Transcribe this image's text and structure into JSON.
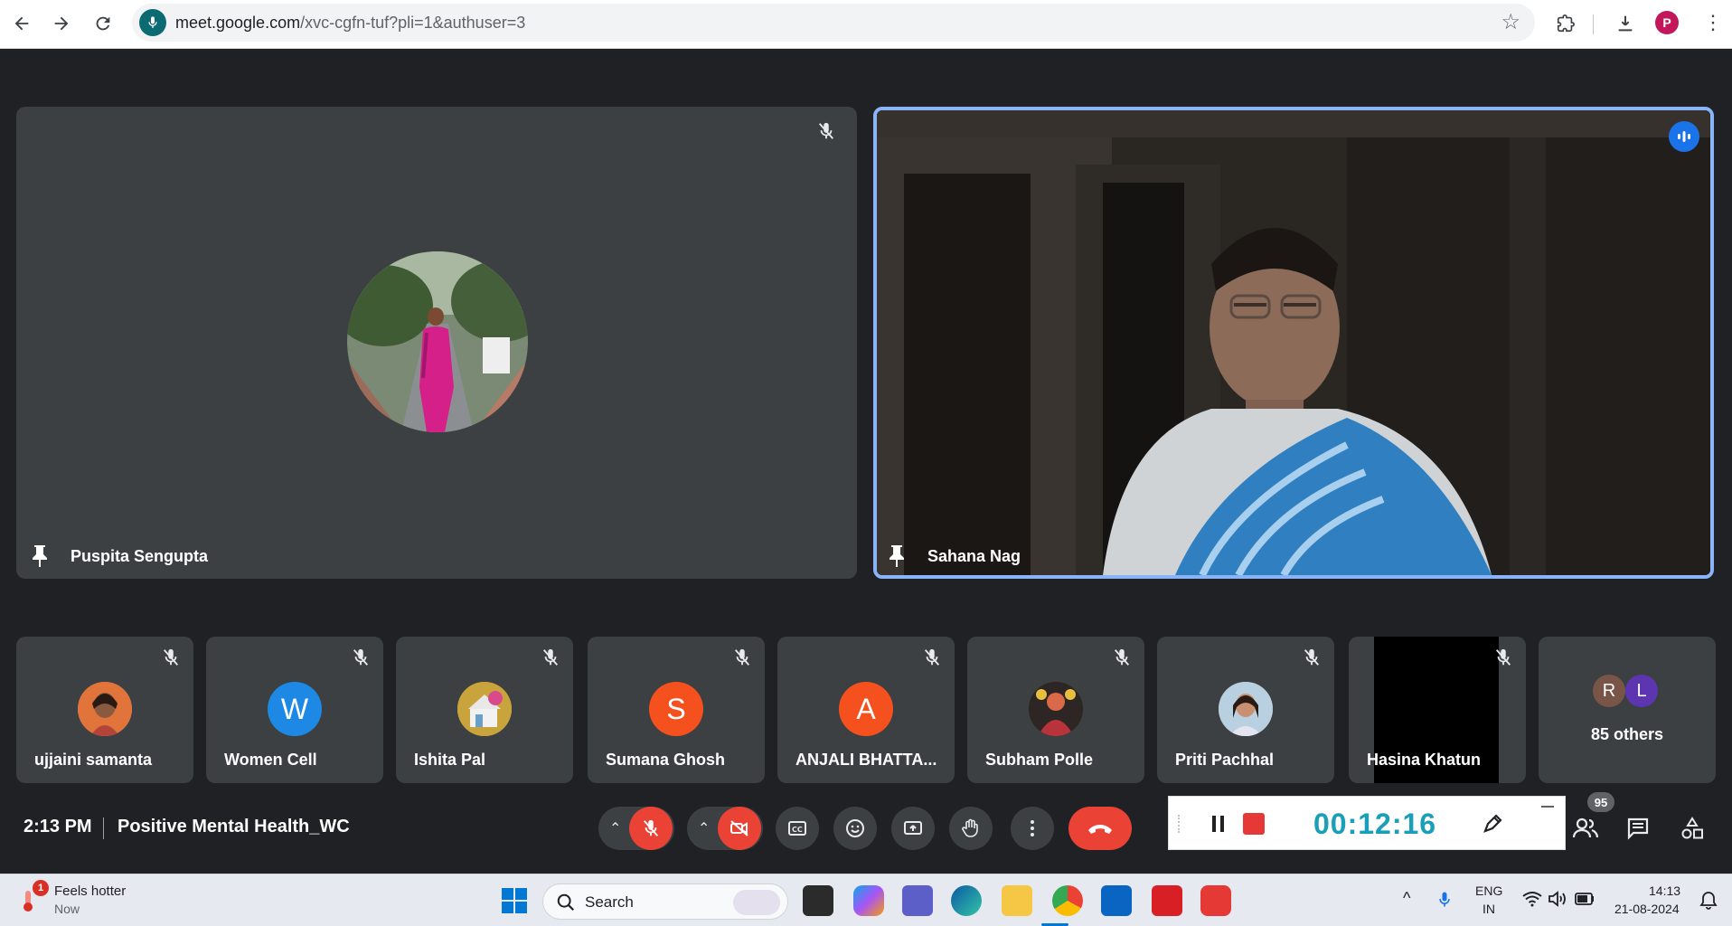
{
  "browser": {
    "url_host": "meet.google.com",
    "url_rest": "/xvc-cgfn-tuf?pli=1&authuser=3",
    "profile_initial": "P"
  },
  "main_tiles": [
    {
      "name": "Puspita Sengupta"
    },
    {
      "name": "Sahana Nag"
    }
  ],
  "strip": [
    {
      "name": "ujjaini samanta",
      "type": "photo"
    },
    {
      "name": "Women Cell",
      "initial": "W",
      "color": "#1e88e5"
    },
    {
      "name": "Ishita Pal",
      "type": "photo"
    },
    {
      "name": "Sumana Ghosh",
      "initial": "S",
      "color": "#f4511e"
    },
    {
      "name": "ANJALI BHATTA...",
      "initial": "A",
      "color": "#f4511e"
    },
    {
      "name": "Subham Polle",
      "type": "photo"
    },
    {
      "name": "Priti Pachhal",
      "type": "photo"
    },
    {
      "name": "Hasina Khatun",
      "type": "video"
    }
  ],
  "others": {
    "label": "85 others",
    "initials": [
      "R",
      "L"
    ]
  },
  "controls": {
    "time": "2:13 PM",
    "meeting_title": "Positive Mental Health_WC",
    "participants_count": "95"
  },
  "recorder": {
    "timer": "00:12:16"
  },
  "taskbar": {
    "weather_title": "Feels hotter",
    "weather_sub": "Now",
    "weather_badge": "1",
    "search_label": "Search",
    "lang_top": "ENG",
    "lang_bottom": "IN",
    "clock_time": "14:13",
    "clock_date": "21-08-2024"
  },
  "colors": {
    "meet_bg": "#202124",
    "tile_bg": "#3c4043",
    "active_speaker": "#8ab4f8",
    "danger": "#ea4335",
    "recorder_timer": "#1a9fb8"
  }
}
